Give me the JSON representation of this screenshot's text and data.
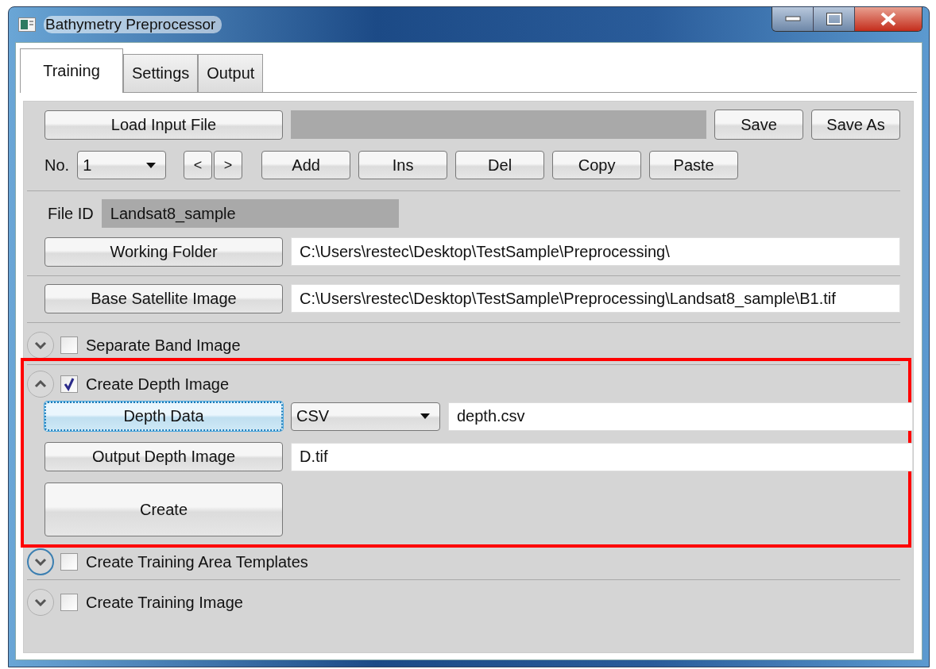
{
  "window": {
    "title": "Bathymetry Preprocessor"
  },
  "tabs": [
    {
      "label": "Training",
      "selected": true
    },
    {
      "label": "Settings",
      "selected": false
    },
    {
      "label": "Output",
      "selected": false
    }
  ],
  "file_row": {
    "load_button": "Load Input File",
    "path_field": {
      "disabled": true
    },
    "buttons": [
      "Save",
      "Save As"
    ]
  },
  "record_row": {
    "label": "No.",
    "number": "1",
    "prev": "<",
    "next": ">",
    "buttons": [
      "Add",
      "Ins",
      "Del",
      "Copy",
      "Paste"
    ]
  },
  "file_id": {
    "label": "File ID",
    "value": "Landsat8_sample",
    "disabled": true
  },
  "paths": [
    {
      "button": "Working Folder",
      "value": "C:\\Users\\restec\\Desktop\\TestSample\\Preprocessing\\"
    },
    {
      "button": "Base Satellite Image",
      "value": "C:\\Users\\restec\\Desktop\\TestSample\\Preprocessing\\Landsat8_sample\\B1.tif"
    }
  ],
  "sections": [
    {
      "title": "Separate Band Image",
      "expanded": false,
      "checked": false,
      "highlighted": false,
      "focused": false
    },
    {
      "title": "Create Depth Image",
      "expanded": true,
      "checked": true,
      "highlighted": true,
      "focused": false,
      "rows": [
        {
          "kind": "select",
          "button": "Depth Data",
          "focused": true,
          "select": "CSV",
          "value": "depth.csv"
        },
        {
          "kind": "field",
          "button": "Output Depth Image",
          "focused": false,
          "value": "D.tif"
        },
        {
          "kind": "action",
          "button": "Create",
          "focused": false
        }
      ]
    },
    {
      "title": "Create Training Area Templates",
      "expanded": false,
      "checked": false,
      "highlighted": false,
      "focused": true
    },
    {
      "title": "Create Training Image",
      "expanded": false,
      "checked": false,
      "highlighted": false,
      "focused": false
    }
  ]
}
